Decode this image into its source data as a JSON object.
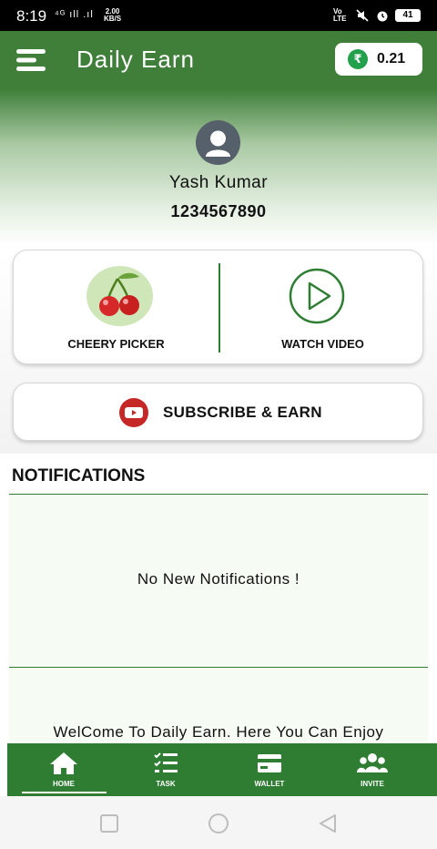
{
  "status_bar": {
    "time": "8:19",
    "network_left": "⁴ᴳ ıll .ıl",
    "speed": "2.00",
    "speed_unit": "KB/S",
    "volte": "Vo LTE",
    "battery": "41"
  },
  "app_bar": {
    "title": "Daily Earn",
    "currency_symbol": "₹",
    "balance": "0.21"
  },
  "profile": {
    "name": "Yash Kumar",
    "phone": "1234567890"
  },
  "tasks": {
    "left_label": "CHEERY PICKER",
    "right_label": "WATCH VIDEO"
  },
  "subscribe": {
    "label": "SUBSCRIBE & EARN"
  },
  "notifications": {
    "title": "NOTIFICATIONS",
    "empty_message": "No New Notifications !",
    "welcome": "WelCome To Daily Earn. Here You Can Enjoy"
  },
  "bottom_nav": {
    "items": [
      {
        "label": "HOME",
        "icon": "home-icon",
        "active": true
      },
      {
        "label": "TASK",
        "icon": "task-list-icon",
        "active": false
      },
      {
        "label": "WALLET",
        "icon": "wallet-icon",
        "active": false
      },
      {
        "label": "INVITE",
        "icon": "group-icon",
        "active": false
      }
    ]
  },
  "colors": {
    "primary_green": "#3f7f3a",
    "nav_green": "#2f7d33",
    "youtube_red": "#c62828"
  }
}
